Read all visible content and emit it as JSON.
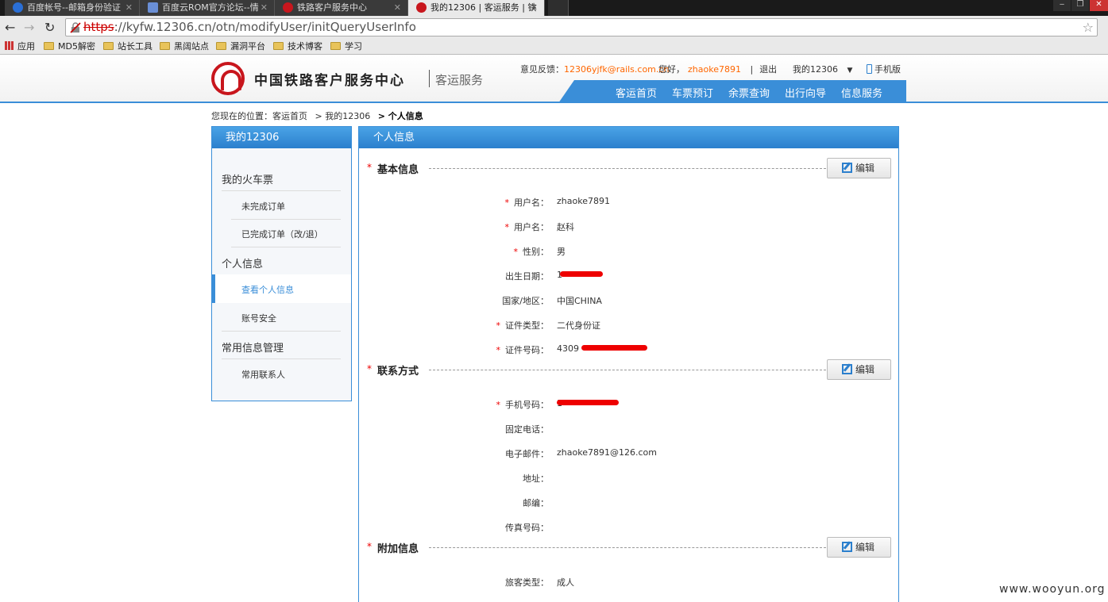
{
  "browser": {
    "tabs": [
      {
        "title": "百度帐号--邮箱身份验证",
        "active": false
      },
      {
        "title": "百度云ROM官方论坛--情",
        "active": false
      },
      {
        "title": "铁路客户服务中心",
        "active": false
      },
      {
        "title": "我的12306 | 客运服务 | 铁",
        "active": true
      }
    ],
    "url_scheme": "https",
    "url_rest": "://kyfw.12306.cn/otn/modifyUser/initQueryUserInfo",
    "bookmarks": [
      "应用",
      "MD5解密",
      "站长工具",
      "黑阔站点",
      "漏洞平台",
      "技术博客",
      "学习"
    ]
  },
  "header": {
    "site_name": "中国铁路客户服务中心",
    "site_sub": "客运服务",
    "feedback_label": "意见反馈：",
    "feedback_email": "12306yjfk@rails.com.cn",
    "greeting": "您好，",
    "username": "zhaoke7891",
    "sep": "|",
    "logout": "退出",
    "my12306": "我的12306",
    "mobile": "手机版",
    "nav": [
      "客运首页",
      "车票预订",
      "余票查询",
      "出行向导",
      "信息服务"
    ]
  },
  "breadcrumb": {
    "prefix": "您现在的位置：",
    "items": [
      "客运首页",
      "> 我的12306",
      "> 个人信息"
    ]
  },
  "sidebar": {
    "title": "我的12306",
    "groups": [
      {
        "label": "我的火车票",
        "items": [
          "未完成订单",
          "已完成订单（改/退）"
        ]
      },
      {
        "label": "个人信息",
        "items": [
          "查看个人信息",
          "账号安全"
        ]
      },
      {
        "label": "常用信息管理",
        "items": [
          "常用联系人"
        ]
      }
    ],
    "active_item": "查看个人信息"
  },
  "main": {
    "title": "个人信息",
    "edit_label": "编辑",
    "sections": [
      {
        "title": "基本信息",
        "fields": [
          {
            "label": "用户名：",
            "value": "zhaoke7891",
            "required": true
          },
          {
            "label": "用户名：",
            "value": "赵科",
            "required": true
          },
          {
            "label": "性别：",
            "value": "男",
            "required": true
          },
          {
            "label": "出生日期：",
            "value": "1",
            "required": false
          },
          {
            "label": "国家/地区：",
            "value": "中国CHINA",
            "required": false
          },
          {
            "label": "证件类型：",
            "value": "二代身份证",
            "required": true
          },
          {
            "label": "证件号码：",
            "value": "4309",
            "required": true
          }
        ]
      },
      {
        "title": "联系方式",
        "fields": [
          {
            "label": "手机号码：",
            "value": "1",
            "required": true
          },
          {
            "label": "固定电话：",
            "value": "",
            "required": false
          },
          {
            "label": "电子邮件：",
            "value": "zhaoke7891@126.com",
            "required": false
          },
          {
            "label": "地址：",
            "value": "",
            "required": false
          },
          {
            "label": "邮编：",
            "value": "",
            "required": false
          },
          {
            "label": "传真号码：",
            "value": "",
            "required": false
          }
        ]
      },
      {
        "title": "附加信息",
        "fields": [
          {
            "label": "旅客类型：",
            "value": "成人",
            "required": false
          }
        ]
      }
    ]
  },
  "watermark": "www.wooyun.org",
  "colors": {
    "brand_blue": "#3a8ed8",
    "accent_orange": "#ff6600",
    "logo_red": "#c8161d",
    "required_red": "#ee0000"
  }
}
